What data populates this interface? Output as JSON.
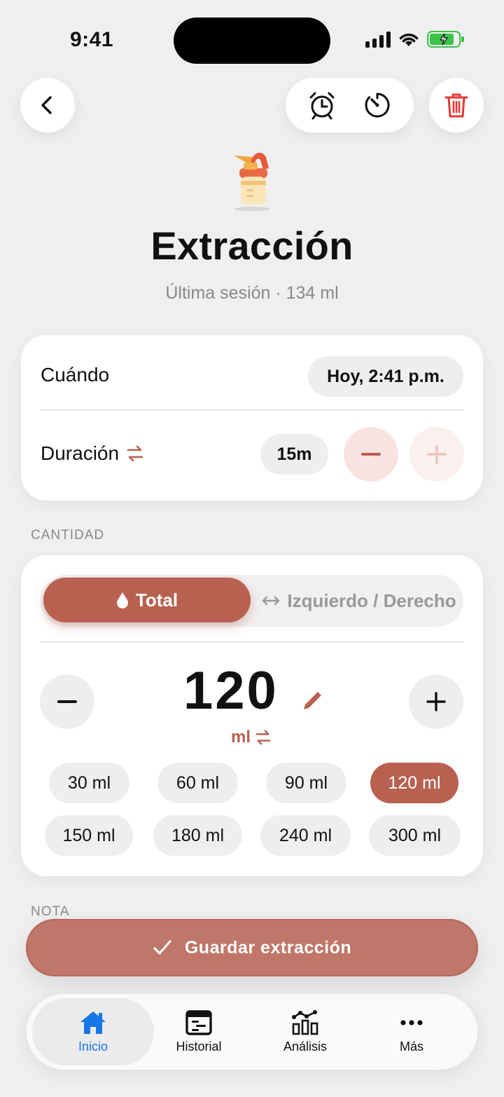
{
  "status_bar": {
    "time": "9:41"
  },
  "header": {
    "title": "Extracción",
    "subtitle": "Última sesión · 134 ml"
  },
  "when_duration": {
    "when_label": "Cuándo",
    "when_value": "Hoy, 2:41 p.m.",
    "duration_label": "Duración",
    "duration_value": "15m"
  },
  "quantity": {
    "section_label": "CANTIDAD",
    "mode_total": "Total",
    "mode_sides": "Izquierdo / Derecho",
    "selected_mode": "Total",
    "value": "120",
    "unit": "ml",
    "presets": [
      "30 ml",
      "60 ml",
      "90 ml",
      "120 ml",
      "150 ml",
      "180 ml",
      "240 ml",
      "300 ml"
    ],
    "selected_preset": "120 ml"
  },
  "note": {
    "section_label": "NOTA"
  },
  "save_button": {
    "label": "Guardar extracción"
  },
  "tabbar": {
    "items": [
      {
        "label": "Inicio",
        "icon": "home-icon"
      },
      {
        "label": "Historial",
        "icon": "history-icon"
      },
      {
        "label": "Análisis",
        "icon": "analytics-icon"
      },
      {
        "label": "Más",
        "icon": "more-icon"
      }
    ],
    "active": "Inicio"
  },
  "colors": {
    "accent": "#b86150",
    "tab_active": "#1877e6",
    "delete": "#e53935",
    "battery": "#3cc24a"
  }
}
